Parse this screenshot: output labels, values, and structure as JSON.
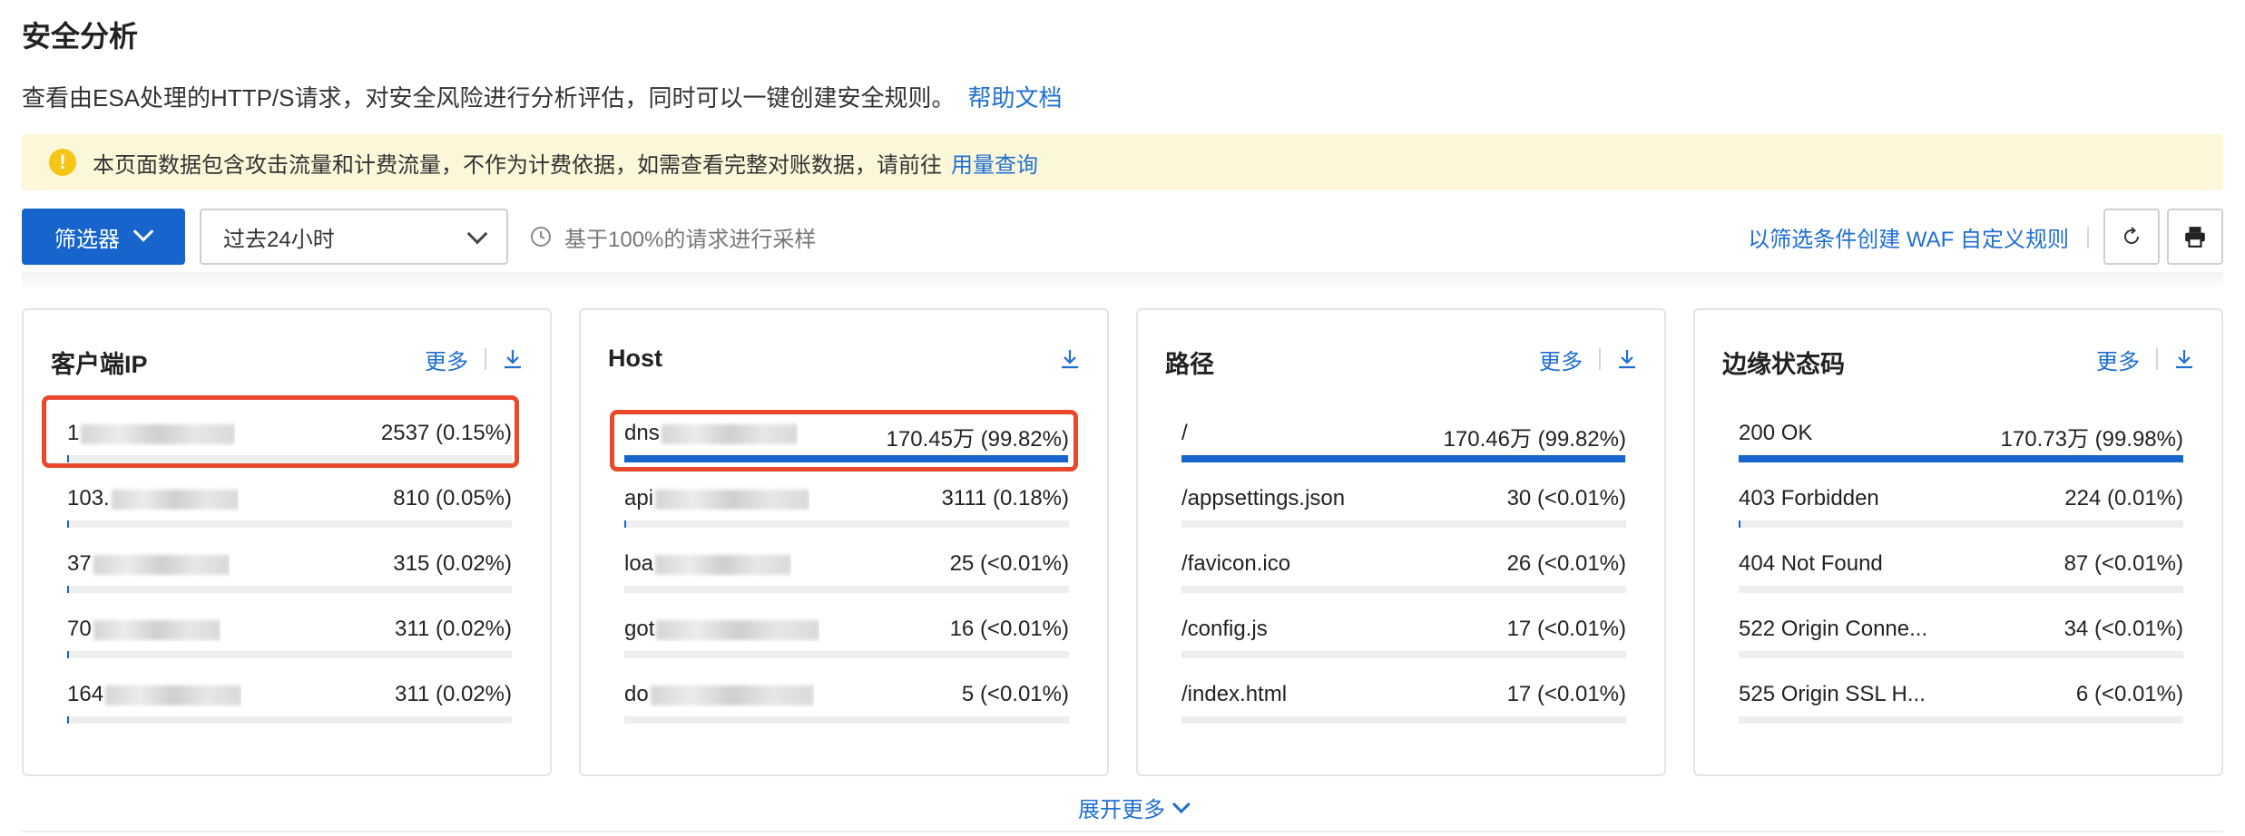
{
  "page": {
    "title": "安全分析",
    "description": "查看由ESA处理的HTTP/S请求，对安全风险进行分析评估，同时可以一键创建安全规则。",
    "help_link": "帮助文档"
  },
  "notice": {
    "text": "本页面数据包含攻击流量和计费流量，不作为计费依据，如需查看完整对账数据，请前往",
    "link": "用量查询"
  },
  "toolbar": {
    "filter_label": "筛选器",
    "time_range": "过去24小时",
    "sampling": "基于100%的请求进行采样",
    "waf_link": "以筛选条件创建 WAF 自定义规则"
  },
  "cards": [
    {
      "title": "客户端IP",
      "more": "更多",
      "rows": [
        {
          "key": "1",
          "value": "2537 (0.15%)",
          "fill": 0.0015
        },
        {
          "key": "103.",
          "value": "810 (0.05%)",
          "fill": 0.0005
        },
        {
          "key": "37",
          "value": "315 (0.02%)",
          "fill": 0.0002
        },
        {
          "key": "70",
          "value": "311 (0.02%)",
          "fill": 0.0002
        },
        {
          "key": "164",
          "value": "311 (0.02%)",
          "fill": 0.0002
        }
      ]
    },
    {
      "title": "Host",
      "more": "",
      "rows": [
        {
          "key": "dns",
          "value": "170.45万 (99.82%)",
          "fill": 0.9982
        },
        {
          "key": "api",
          "value": "3111 (0.18%)",
          "fill": 0.0018
        },
        {
          "key": "loa",
          "value": "25 (<0.01%)",
          "fill": 0
        },
        {
          "key": "got",
          "value": "16 (<0.01%)",
          "fill": 0
        },
        {
          "key": "do",
          "value": "5 (<0.01%)",
          "fill": 0
        }
      ]
    },
    {
      "title": "路径",
      "more": "更多",
      "rows": [
        {
          "key": "/",
          "value": "170.46万 (99.82%)",
          "fill": 0.9982
        },
        {
          "key": "/appsettings.json",
          "value": "30 (<0.01%)",
          "fill": 0
        },
        {
          "key": "/favicon.ico",
          "value": "26 (<0.01%)",
          "fill": 0
        },
        {
          "key": "/config.js",
          "value": "17 (<0.01%)",
          "fill": 0
        },
        {
          "key": "/index.html",
          "value": "17 (<0.01%)",
          "fill": 0
        }
      ]
    },
    {
      "title": "边缘状态码",
      "more": "更多",
      "rows": [
        {
          "key": "200 OK",
          "value": "170.73万 (99.98%)",
          "fill": 0.9998
        },
        {
          "key": "403 Forbidden",
          "value": "224 (0.01%)",
          "fill": 0.0001
        },
        {
          "key": "404 Not Found",
          "value": "87 (<0.01%)",
          "fill": 0
        },
        {
          "key": "522 Origin Conne...",
          "value": "34 (<0.01%)",
          "fill": 0
        },
        {
          "key": "525 Origin SSL H...",
          "value": "6 (<0.01%)",
          "fill": 0
        }
      ]
    }
  ],
  "expand_more": "展开更多",
  "colors": {
    "accent": "#1764cc",
    "link": "#1f6fd1",
    "notice_bg": "#fdf7d9",
    "warning_icon": "#f5c518",
    "highlight": "#e8492c"
  },
  "icons": [
    "warning-icon",
    "chevron-down-icon",
    "clock-icon",
    "refresh-icon",
    "print-icon",
    "download-icon"
  ]
}
